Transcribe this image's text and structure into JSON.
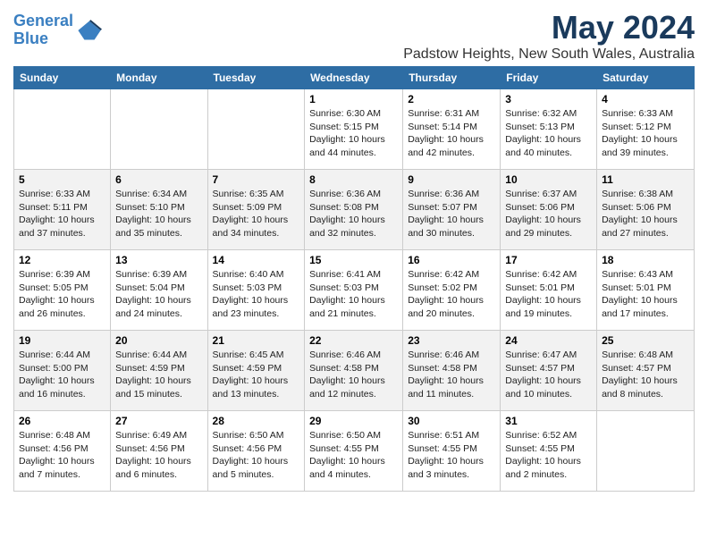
{
  "header": {
    "logo_line1": "General",
    "logo_line2": "Blue",
    "title": "May 2024",
    "subtitle": "Padstow Heights, New South Wales, Australia"
  },
  "columns": [
    "Sunday",
    "Monday",
    "Tuesday",
    "Wednesday",
    "Thursday",
    "Friday",
    "Saturday"
  ],
  "weeks": [
    {
      "days": [
        {
          "num": "",
          "detail": ""
        },
        {
          "num": "",
          "detail": ""
        },
        {
          "num": "",
          "detail": ""
        },
        {
          "num": "1",
          "detail": "Sunrise: 6:30 AM\nSunset: 5:15 PM\nDaylight: 10 hours\nand 44 minutes."
        },
        {
          "num": "2",
          "detail": "Sunrise: 6:31 AM\nSunset: 5:14 PM\nDaylight: 10 hours\nand 42 minutes."
        },
        {
          "num": "3",
          "detail": "Sunrise: 6:32 AM\nSunset: 5:13 PM\nDaylight: 10 hours\nand 40 minutes."
        },
        {
          "num": "4",
          "detail": "Sunrise: 6:33 AM\nSunset: 5:12 PM\nDaylight: 10 hours\nand 39 minutes."
        }
      ]
    },
    {
      "days": [
        {
          "num": "5",
          "detail": "Sunrise: 6:33 AM\nSunset: 5:11 PM\nDaylight: 10 hours\nand 37 minutes."
        },
        {
          "num": "6",
          "detail": "Sunrise: 6:34 AM\nSunset: 5:10 PM\nDaylight: 10 hours\nand 35 minutes."
        },
        {
          "num": "7",
          "detail": "Sunrise: 6:35 AM\nSunset: 5:09 PM\nDaylight: 10 hours\nand 34 minutes."
        },
        {
          "num": "8",
          "detail": "Sunrise: 6:36 AM\nSunset: 5:08 PM\nDaylight: 10 hours\nand 32 minutes."
        },
        {
          "num": "9",
          "detail": "Sunrise: 6:36 AM\nSunset: 5:07 PM\nDaylight: 10 hours\nand 30 minutes."
        },
        {
          "num": "10",
          "detail": "Sunrise: 6:37 AM\nSunset: 5:06 PM\nDaylight: 10 hours\nand 29 minutes."
        },
        {
          "num": "11",
          "detail": "Sunrise: 6:38 AM\nSunset: 5:06 PM\nDaylight: 10 hours\nand 27 minutes."
        }
      ]
    },
    {
      "days": [
        {
          "num": "12",
          "detail": "Sunrise: 6:39 AM\nSunset: 5:05 PM\nDaylight: 10 hours\nand 26 minutes."
        },
        {
          "num": "13",
          "detail": "Sunrise: 6:39 AM\nSunset: 5:04 PM\nDaylight: 10 hours\nand 24 minutes."
        },
        {
          "num": "14",
          "detail": "Sunrise: 6:40 AM\nSunset: 5:03 PM\nDaylight: 10 hours\nand 23 minutes."
        },
        {
          "num": "15",
          "detail": "Sunrise: 6:41 AM\nSunset: 5:03 PM\nDaylight: 10 hours\nand 21 minutes."
        },
        {
          "num": "16",
          "detail": "Sunrise: 6:42 AM\nSunset: 5:02 PM\nDaylight: 10 hours\nand 20 minutes."
        },
        {
          "num": "17",
          "detail": "Sunrise: 6:42 AM\nSunset: 5:01 PM\nDaylight: 10 hours\nand 19 minutes."
        },
        {
          "num": "18",
          "detail": "Sunrise: 6:43 AM\nSunset: 5:01 PM\nDaylight: 10 hours\nand 17 minutes."
        }
      ]
    },
    {
      "days": [
        {
          "num": "19",
          "detail": "Sunrise: 6:44 AM\nSunset: 5:00 PM\nDaylight: 10 hours\nand 16 minutes."
        },
        {
          "num": "20",
          "detail": "Sunrise: 6:44 AM\nSunset: 4:59 PM\nDaylight: 10 hours\nand 15 minutes."
        },
        {
          "num": "21",
          "detail": "Sunrise: 6:45 AM\nSunset: 4:59 PM\nDaylight: 10 hours\nand 13 minutes."
        },
        {
          "num": "22",
          "detail": "Sunrise: 6:46 AM\nSunset: 4:58 PM\nDaylight: 10 hours\nand 12 minutes."
        },
        {
          "num": "23",
          "detail": "Sunrise: 6:46 AM\nSunset: 4:58 PM\nDaylight: 10 hours\nand 11 minutes."
        },
        {
          "num": "24",
          "detail": "Sunrise: 6:47 AM\nSunset: 4:57 PM\nDaylight: 10 hours\nand 10 minutes."
        },
        {
          "num": "25",
          "detail": "Sunrise: 6:48 AM\nSunset: 4:57 PM\nDaylight: 10 hours\nand 8 minutes."
        }
      ]
    },
    {
      "days": [
        {
          "num": "26",
          "detail": "Sunrise: 6:48 AM\nSunset: 4:56 PM\nDaylight: 10 hours\nand 7 minutes."
        },
        {
          "num": "27",
          "detail": "Sunrise: 6:49 AM\nSunset: 4:56 PM\nDaylight: 10 hours\nand 6 minutes."
        },
        {
          "num": "28",
          "detail": "Sunrise: 6:50 AM\nSunset: 4:56 PM\nDaylight: 10 hours\nand 5 minutes."
        },
        {
          "num": "29",
          "detail": "Sunrise: 6:50 AM\nSunset: 4:55 PM\nDaylight: 10 hours\nand 4 minutes."
        },
        {
          "num": "30",
          "detail": "Sunrise: 6:51 AM\nSunset: 4:55 PM\nDaylight: 10 hours\nand 3 minutes."
        },
        {
          "num": "31",
          "detail": "Sunrise: 6:52 AM\nSunset: 4:55 PM\nDaylight: 10 hours\nand 2 minutes."
        },
        {
          "num": "",
          "detail": ""
        }
      ]
    }
  ]
}
